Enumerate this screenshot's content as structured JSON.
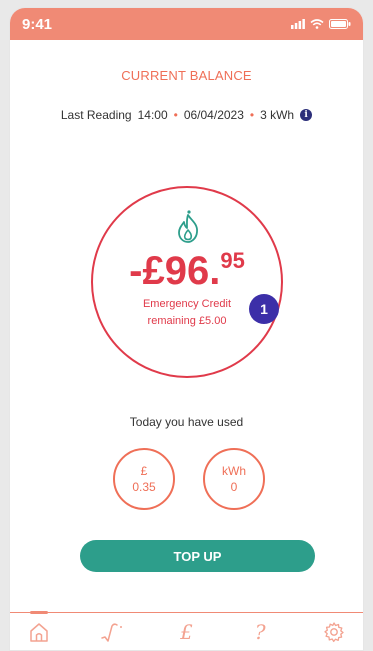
{
  "status_bar": {
    "time": "9:41"
  },
  "balance": {
    "heading": "CURRENT BALANCE",
    "last_reading_label": "Last Reading",
    "last_reading_time": "14:00",
    "last_reading_date": "06/04/2023",
    "last_reading_kwh": "3 kWh",
    "info_icon_glyph": "i",
    "amount_main": "-£96.",
    "amount_cents": "95",
    "emergency_line1": "Emergency Credit",
    "emergency_line2": "remaining £5.00",
    "badge": "1"
  },
  "usage": {
    "label": "Today you have used",
    "money_unit": "£",
    "money_value": "0.35",
    "energy_unit": "kWh",
    "energy_value": "0"
  },
  "actions": {
    "topup_label": "TOP UP"
  },
  "nav": {
    "items": [
      {
        "icon": "home-icon"
      },
      {
        "icon": "chart-icon"
      },
      {
        "icon": "pound-icon",
        "glyph": "£"
      },
      {
        "icon": "help-icon",
        "glyph": "?"
      },
      {
        "icon": "gear-icon"
      }
    ]
  },
  "colors": {
    "accent": "#ef6f57",
    "status_bar": "#f08a75",
    "balance_red": "#e03a4a",
    "topup_green": "#2d9e8b",
    "badge_purple": "#3c2fa8",
    "info_navy": "#2c2f7a"
  }
}
